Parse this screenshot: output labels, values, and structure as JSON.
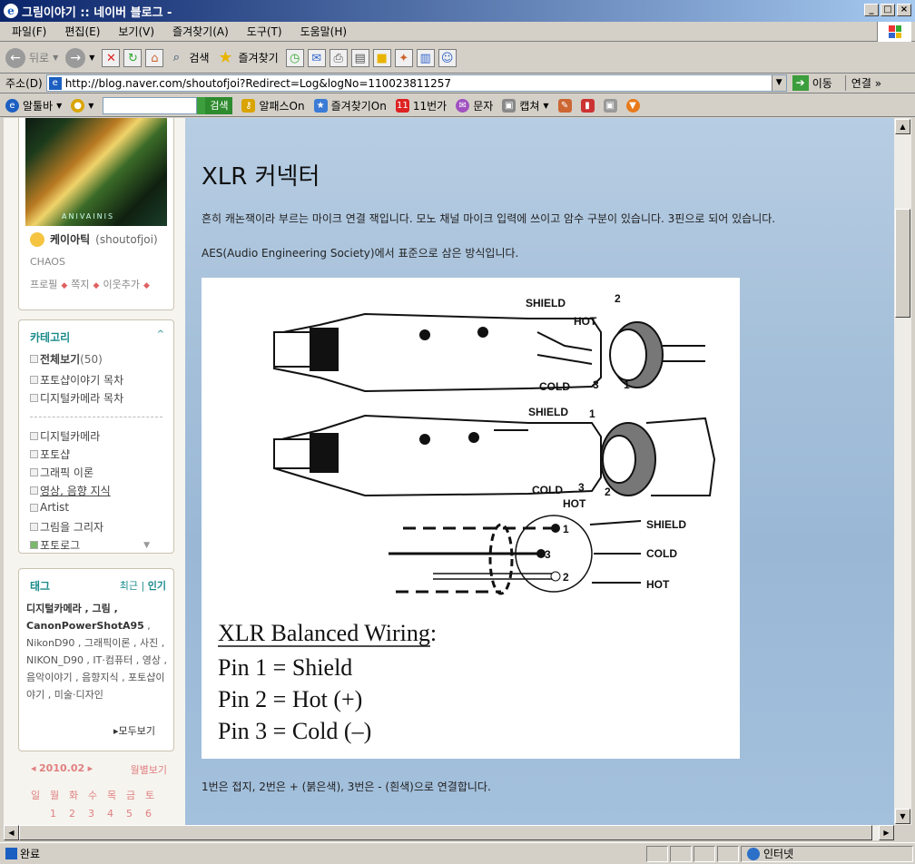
{
  "window": {
    "title": "그림이야기 :: 네이버 블로그 -",
    "controls": [
      "_",
      "□",
      "×"
    ]
  },
  "menu": [
    "파일(F)",
    "편집(E)",
    "보기(V)",
    "즐겨찾기(A)",
    "도구(T)",
    "도움말(H)"
  ],
  "toolbar": {
    "back": "뒤로",
    "search": "검색",
    "favorites": "즐겨찾기"
  },
  "address": {
    "label": "주소(D)",
    "url": "http://blog.naver.com/shoutofjoi?Redirect=Log&logNo=110023811257",
    "go": "이동",
    "links": "연결"
  },
  "altoolbar": {
    "altool": "알툴바",
    "search_btn": "검색",
    "alpass": "알패스On",
    "favon": "즐겨찾기On",
    "eleven": "11번가",
    "sms": "문자",
    "capture": "캡쳐"
  },
  "profile": {
    "banner": "ANIVAINIS",
    "nickname": "케이아틱",
    "id": "(shoutofjoi)",
    "desc": "CHAOS",
    "links": [
      "프로필",
      "쪽지",
      "이웃추가"
    ]
  },
  "category": {
    "title": "카테고리",
    "toggle": "^",
    "items": [
      {
        "label": "전체보기",
        "count": "(50)"
      },
      {
        "label": "포토샵이야기 목차"
      },
      {
        "label": "디지털카메라 목차"
      },
      {
        "label": "디지털카메라"
      },
      {
        "label": "포토샵"
      },
      {
        "label": "그래픽 이론"
      },
      {
        "label": "영상, 음향 지식"
      },
      {
        "label": "Artist"
      },
      {
        "label": "그림을 그리자"
      },
      {
        "label": "포토로그"
      }
    ]
  },
  "tags": {
    "title": "태그",
    "recent": "최근",
    "popular": "인기",
    "cloud_bold": "디지털카메라 , 그림 , CanonPowerShotA95",
    "cloud": " , NikonD90 , 그래픽이론 , 사진 , NIKON_D90 , IT·컴퓨터 , 영상 , 음악이야기 , 음향지식 , 포토샵이야기 , 미술·디자인",
    "more": "▸모두보기"
  },
  "calendar": {
    "month": "2010.02",
    "view": "월별보기",
    "days": [
      "일",
      "월",
      "화",
      "수",
      "목",
      "금",
      "토"
    ],
    "dates": [
      "",
      "1",
      "2",
      "3",
      "4",
      "5",
      "6"
    ]
  },
  "post": {
    "title": "XLR 커넥터",
    "p1": "흔히 캐논잭이라 부르는 마이크 연결 잭입니다. 모노 채널 마이크 입력에 쓰이고 암수 구분이 있습니다. 3핀으로 되어 있습니다.",
    "p2": "AES(Audio Engineering Society)에서 표준으로 삼은 방식입니다.",
    "p3": "1번은 접지, 2번은 + (붉은색), 3번은 - (흰색)으로 연결합니다."
  },
  "diagram": {
    "shield": "SHIELD",
    "hot": "HOT",
    "cold": "COLD",
    "pin1": "1",
    "pin2": "2",
    "pin3": "3",
    "heading": "XLR Balanced Wiring:",
    "line1": "Pin 1 = Shield",
    "line2": "Pin 2 = Hot (+)",
    "line3": "Pin 3 = Cold (–)"
  },
  "status": {
    "text": "완료",
    "zone": "인터넷"
  }
}
